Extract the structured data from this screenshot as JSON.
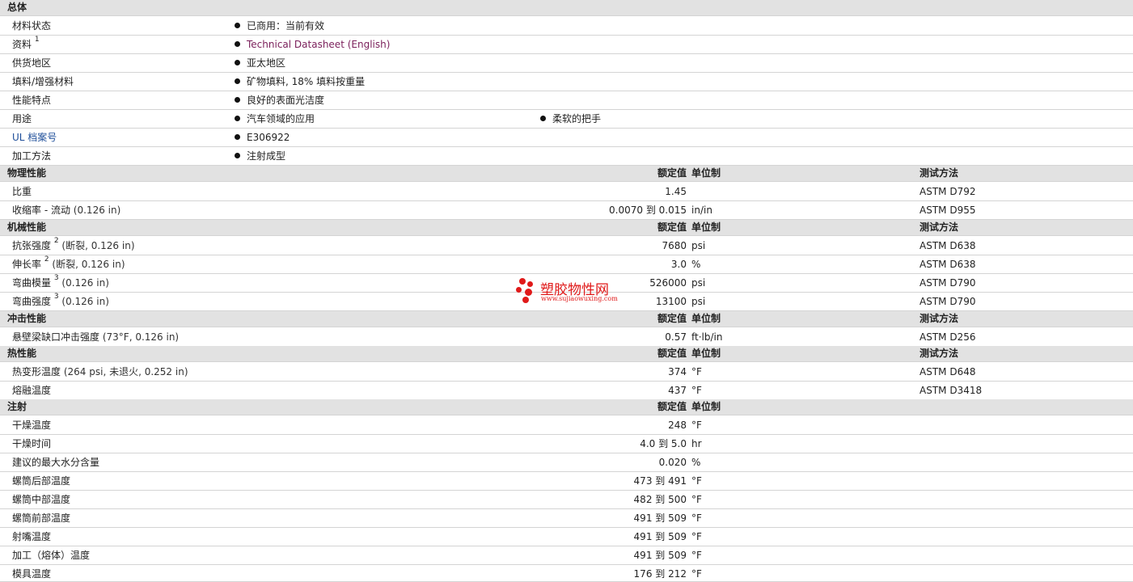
{
  "general": {
    "title": "总体",
    "status": {
      "label": "材料状态",
      "value": "已商用：当前有效"
    },
    "docs": {
      "label": "资料",
      "note": "1",
      "value": "Technical Datasheet (English)"
    },
    "region": {
      "label": "供货地区",
      "value": "亚太地区"
    },
    "filler": {
      "label": "填料/增强材料",
      "value": "矿物填料, 18% 填料按重量"
    },
    "features": {
      "label": "性能特点",
      "value": "良好的表面光洁度"
    },
    "uses": {
      "label": "用途",
      "value1": "汽车领域的应用",
      "value2": "柔软的把手"
    },
    "ul": {
      "label": "UL 档案号",
      "value": "E306922"
    },
    "processing": {
      "label": "加工方法",
      "value": "注射成型"
    }
  },
  "headers": {
    "nominal": "额定值",
    "unit": "单位制",
    "test": "测试方法"
  },
  "physical": {
    "title": "物理性能",
    "rows": [
      {
        "label": "比重",
        "cond": "",
        "value": "1.45",
        "unit": "",
        "test": "ASTM D792"
      },
      {
        "label": "收缩率 - 流动",
        "cond": "(0.126 in)",
        "value": "0.0070 到  0.015",
        "unit": "in/in",
        "test": "ASTM D955"
      }
    ]
  },
  "mechanical": {
    "title": "机械性能",
    "rows": [
      {
        "label": "抗张强度",
        "note": "2",
        "cond": "(断裂, 0.126 in)",
        "value": "7680",
        "unit": "psi",
        "test": "ASTM D638"
      },
      {
        "label": "伸长率",
        "note": "2",
        "cond": "(断裂, 0.126 in)",
        "value": "3.0",
        "unit": "%",
        "test": "ASTM D638"
      },
      {
        "label": "弯曲模量",
        "note": "3",
        "cond": "(0.126 in)",
        "value": "526000",
        "unit": "psi",
        "test": "ASTM D790"
      },
      {
        "label": "弯曲强度",
        "note": "3",
        "cond": "(0.126 in)",
        "value": "13100",
        "unit": "psi",
        "test": "ASTM D790"
      }
    ]
  },
  "impact": {
    "title": "冲击性能",
    "rows": [
      {
        "label": "悬壁梁缺口冲击强度",
        "cond": "(73°F, 0.126 in)",
        "value": "0.57",
        "unit": "ft·lb/in",
        "test": "ASTM D256"
      }
    ]
  },
  "thermal": {
    "title": "热性能",
    "rows": [
      {
        "label": "热变形温度",
        "cond": "(264 psi, 未退火, 0.252 in)",
        "value": "374",
        "unit": "°F",
        "test": "ASTM D648"
      },
      {
        "label": "熔融温度",
        "cond": "",
        "value": "437",
        "unit": "°F",
        "test": "ASTM D3418"
      }
    ]
  },
  "injection": {
    "title": "注射",
    "rows": [
      {
        "label": "干燥温度",
        "value": "248",
        "unit": "°F"
      },
      {
        "label": "干燥时间",
        "value": "4.0 到  5.0",
        "unit": "hr"
      },
      {
        "label": "建议的最大水分含量",
        "value": "0.020",
        "unit": "%"
      },
      {
        "label": "螺筒后部温度",
        "value": "473 到  491",
        "unit": "°F"
      },
      {
        "label": "螺筒中部温度",
        "value": "482 到  500",
        "unit": "°F"
      },
      {
        "label": "螺筒前部温度",
        "value": "491 到  509",
        "unit": "°F"
      },
      {
        "label": "射嘴温度",
        "value": "491 到  509",
        "unit": "°F"
      },
      {
        "label": "加工（熔体）温度",
        "value": "491 到  509",
        "unit": "°F"
      },
      {
        "label": "模具温度",
        "value": "176 到  212",
        "unit": "°F"
      }
    ]
  },
  "watermark": {
    "name": "塑胶物性网",
    "url": "www.sujiaowuxing.com",
    "color": "#e01a1a"
  }
}
